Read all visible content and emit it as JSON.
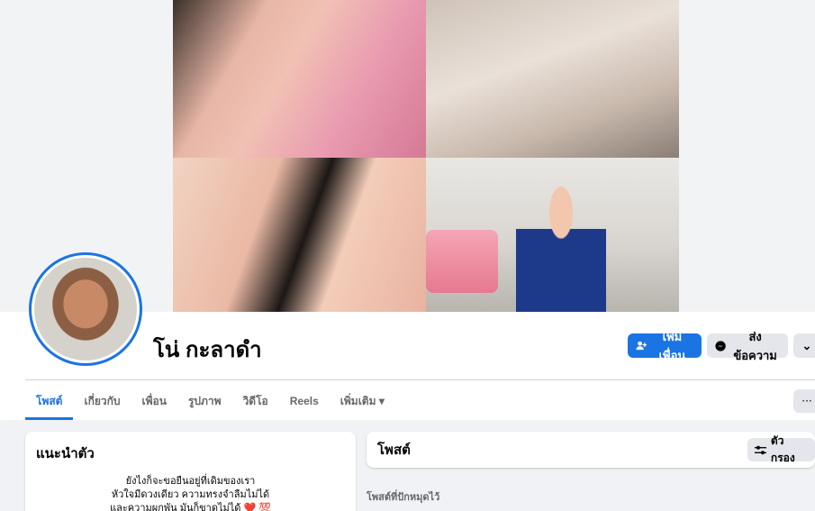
{
  "profile": {
    "name": "โน่ กะลาดำ"
  },
  "actions": {
    "add_friend_label": "เพิ่มเพื่อน",
    "message_label": "ส่งข้อความ",
    "more_glyph": "⌄"
  },
  "tabs": [
    {
      "label": "โพสต์",
      "active": true
    },
    {
      "label": "เกี่ยวกับ",
      "active": false
    },
    {
      "label": "เพื่อน",
      "active": false
    },
    {
      "label": "รูปภาพ",
      "active": false
    },
    {
      "label": "วิดีโอ",
      "active": false
    },
    {
      "label": "Reels",
      "active": false
    },
    {
      "label": "เพิ่มเติม ▾",
      "active": false
    }
  ],
  "tabs_more_glyph": "···",
  "intro": {
    "title": "แนะนำตัว",
    "bio_lines": [
      "ยังไงก็จะขอยืนอยู่ที่เดิมของเรา",
      "หัวใจมีดวงเดียว ความทรงจำลืมไม่ได้",
      "และความผูกพัน มันก็ขาดไม่ได้ ❤️ 💯"
    ]
  },
  "posts": {
    "title": "โพสต์",
    "filter_label": "ตัวกรอง",
    "pinned_label": "โพสต์ที่ปักหมุดไว้"
  },
  "colors": {
    "accent": "#1b74e4",
    "secondary_button": "#e4e6eb",
    "feed_background": "#f0f2f5"
  }
}
